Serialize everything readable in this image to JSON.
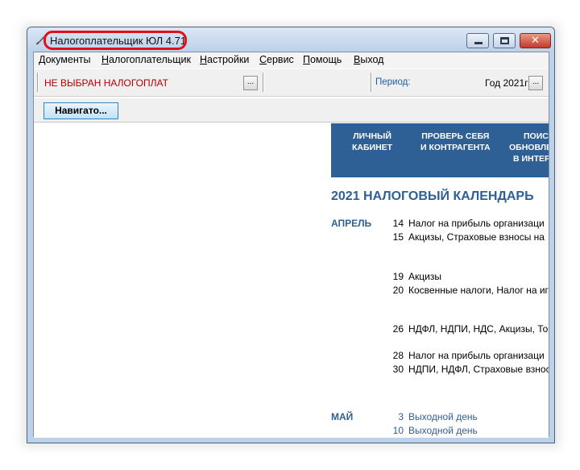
{
  "window": {
    "title": "Налогоплательщик ЮЛ 4.71",
    "controls": {
      "minimize": "minimize",
      "maximize": "maximize",
      "close": "✕"
    }
  },
  "menu": [
    "Документы",
    "Налогоплательщик",
    "Настройки",
    "Сервис",
    "Помощь",
    "Выход"
  ],
  "toolbar": {
    "taxpayer": "НЕ ВЫБРАН НАЛОГОПЛАТ",
    "taxpayer_button": "...",
    "period_label": "Период:",
    "period_value": "Год 2021г",
    "period_button": "..."
  },
  "navigator": {
    "label": "Навигато..."
  },
  "banner": [
    {
      "line1": "ЛИЧНЫЙ",
      "line2": "КАБИНЕТ"
    },
    {
      "line1": "ПРОВЕРЬ СЕБЯ",
      "line2": "И КОНТРАГЕНТА"
    },
    {
      "line1": "ПОИС",
      "line2": "ОБНОВЛЕ",
      "line3": "В ИНТЕР"
    }
  ],
  "calendar": {
    "title": "2021  НАЛОГОВЫЙ КАЛЕНДАРЬ",
    "months": [
      {
        "name": "АПРЕЛЬ",
        "entries": [
          {
            "day": "14",
            "text": "Налог на прибыль организаци"
          },
          {
            "day": "15",
            "text": "Акцизы, Страховые взносы на"
          },
          {
            "day": "19",
            "text": "Акцизы"
          },
          {
            "day": "20",
            "text": "Косвенные налоги, Налог на иг"
          },
          {
            "day": "26",
            "text": "НДФЛ, НДПИ, НДС, Акцизы, То"
          },
          {
            "day": "28",
            "text": "Налог на прибыль организаци"
          },
          {
            "day": "30",
            "text": "НДПИ, НДФЛ, Страховые взнос"
          }
        ]
      },
      {
        "name": "МАЙ",
        "entries": [
          {
            "day": "3",
            "text": "Выходной день"
          },
          {
            "day": "10",
            "text": "Выходной день"
          }
        ]
      }
    ]
  },
  "colors": {
    "accent": "#2f6095",
    "warning_text": "#b00000",
    "highlight": "#e0101a"
  }
}
